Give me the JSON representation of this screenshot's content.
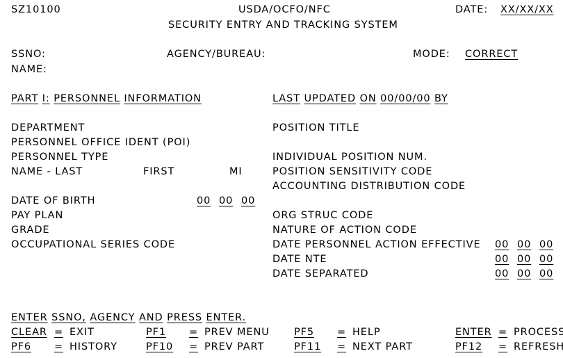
{
  "screen": {
    "terminal_id": "SZ10100",
    "agency_line1": "USDA/OCFO/NFC",
    "agency_line2": "SECURITY ENTRY AND TRACKING SYSTEM",
    "date_label": "DATE:",
    "date_value": "XX/XX/XX",
    "background_color": "#ffffff",
    "text_color": "#000000"
  },
  "header_fields": {
    "ssno_label": "SSNO:",
    "ssno_value": "",
    "agency_bureau_label": "AGENCY/BUREAU:",
    "agency_bureau_value": "",
    "mode_label": "MODE:",
    "mode_value": "CORRECT",
    "name_label": "NAME:",
    "name_value": ""
  },
  "part_header": {
    "title_words": [
      "PART",
      "I:",
      "PERSONNEL",
      "INFORMATION"
    ],
    "last_updated_words": [
      "LAST",
      "UPDATED",
      "ON",
      "00/00/00",
      "BY"
    ]
  },
  "left_column": {
    "department": "DEPARTMENT",
    "poi": "PERSONNEL OFFICE IDENT (POI)",
    "personnel_type": "PERSONNEL TYPE",
    "name_last": "NAME - LAST",
    "name_first": "FIRST",
    "name_mi": "MI",
    "date_of_birth": "DATE OF BIRTH",
    "date_of_birth_mm": "00",
    "date_of_birth_dd": "00",
    "date_of_birth_yy": "00",
    "pay_plan": "PAY PLAN",
    "grade": "GRADE",
    "occupational_series_code": "OCCUPATIONAL SERIES CODE"
  },
  "right_column": {
    "position_title": "POSITION TITLE",
    "individual_position_num": "INDIVIDUAL POSITION NUM.",
    "position_sensitivity_code": "POSITION SENSITIVITY CODE",
    "accounting_distribution_code": "ACCOUNTING DISTRIBUTION CODE",
    "org_struc_code": "ORG STRUC CODE",
    "nature_of_action_code": "NATURE OF ACTION CODE",
    "date_personnel_action_effective": "DATE PERSONNEL ACTION EFFECTIVE",
    "dpae_mm": "00",
    "dpae_dd": "00",
    "dpae_yy": "00",
    "date_nte": "DATE NTE",
    "nte_mm": "00",
    "nte_dd": "00",
    "nte_yy": "00",
    "date_separated": "DATE SEPARATED",
    "sep_mm": "00",
    "sep_dd": "00",
    "sep_yy": "00"
  },
  "instruction": {
    "words": [
      "ENTER",
      "SSNO,",
      "AGENCY",
      "AND",
      "PRESS",
      "ENTER."
    ]
  },
  "function_keys": [
    {
      "key": "CLEAR",
      "eq": "=",
      "action": "EXIT",
      "col": 0,
      "row": 0
    },
    {
      "key": "PF1",
      "eq": "=",
      "action": "PREV MENU",
      "col": 1,
      "row": 0
    },
    {
      "key": "PF5",
      "eq": "=",
      "action": "HELP",
      "col": 2,
      "row": 0
    },
    {
      "key": "ENTER",
      "eq": "=",
      "action": "PROCESS",
      "col": 3,
      "row": 0
    },
    {
      "key": "PF6",
      "eq": "=",
      "action": "HISTORY",
      "col": 0,
      "row": 1
    },
    {
      "key": "PF10",
      "eq": "=",
      "action": "PREV PART",
      "col": 1,
      "row": 1
    },
    {
      "key": "PF11",
      "eq": "=",
      "action": "NEXT PART",
      "col": 2,
      "row": 1
    },
    {
      "key": "PF12",
      "eq": "=",
      "action": "REFRESH",
      "col": 3,
      "row": 1
    }
  ]
}
